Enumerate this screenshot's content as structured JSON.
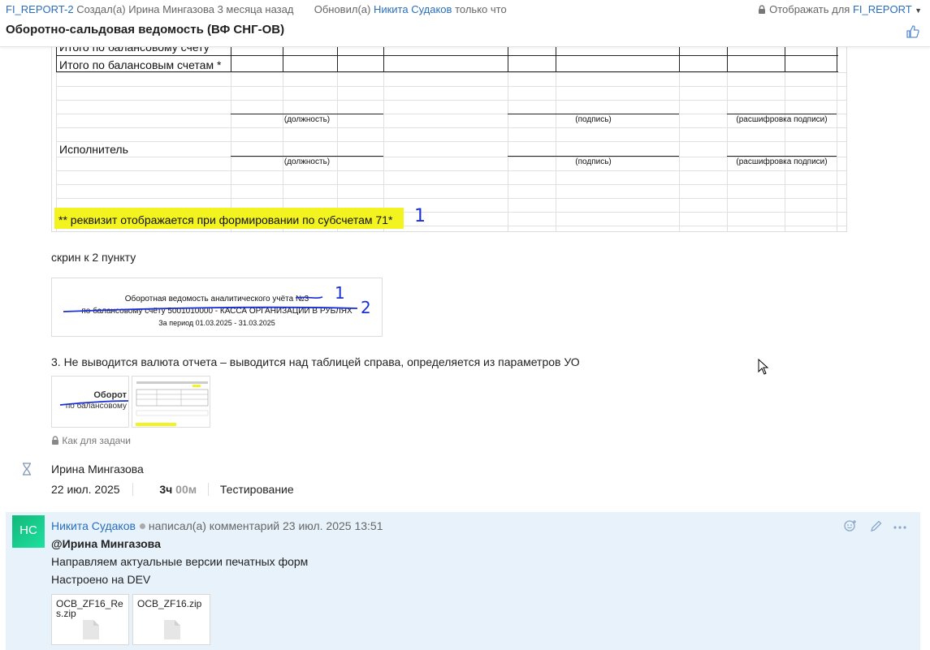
{
  "header": {
    "issue_key": "FI_REPORT-2",
    "created_by_label": "Создал(а)",
    "creator": "Ирина Мингазова",
    "created_when": "3 месяца назад",
    "updated_by_label": "Обновил(а)",
    "updater": "Никита Судаков",
    "updated_when": "только что",
    "visibility_label": "Отображать для",
    "visibility_target": "FI_REPORT",
    "title": "Оборотно-сальдовая ведомость (ВФ СНГ-ОВ)"
  },
  "sheet": {
    "row_total_sub": "Итого по балансовому счету",
    "row_total": "Итого по балансовым счетам *",
    "cap_position": "(должность)",
    "cap_signature": "(подпись)",
    "cap_decoding": "(расшифровка подписи)",
    "executor": "Исполнитель",
    "note": "** реквизит отображается при формировании по субсчетам 71*",
    "hand_mark": "1"
  },
  "caption_screen2": "скрин к 2 пункту",
  "image2": {
    "line1": "Оборотная ведомость аналитического учёта №3",
    "line2": "по балансовому счёту 5001010000 - КАССА ОРГАНИЗАЦИИ В РУБЛЯХ",
    "line3": "За период 01.03.2025 - 31.03.2025",
    "mark1": "1",
    "mark2": "2"
  },
  "point3": "3. Не выводится валюта отчета – выводится над таблицей справа, определяется из параметров УО",
  "thumb1": {
    "line1": "Оборот",
    "line2": "по балансовому"
  },
  "visibility_note": "Как для задачи",
  "worklog": {
    "author": "Ирина Мингазова",
    "date": "22 июл. 2025",
    "hours": "3ч",
    "minutes": "00м",
    "activity": "Тестирование"
  },
  "comment": {
    "avatar_initials": "НС",
    "author": "Никита Судаков",
    "action": "написал(а) комментарий",
    "timestamp": "23 июл. 2025 13:51",
    "mention": "@Ирина Мингазова",
    "line1": "Направляем актуальные версии печатных форм",
    "line2": "Настроено на DEV",
    "attachments": [
      {
        "name": "OCB_ZF16_Res.zip"
      },
      {
        "name": "OCB_ZF16.zip"
      }
    ]
  },
  "colors": {
    "link": "#2a6ebb",
    "highlight": "#f3f41f",
    "comment_bg": "#e8f2fb",
    "ink": "#1a2fd6"
  }
}
